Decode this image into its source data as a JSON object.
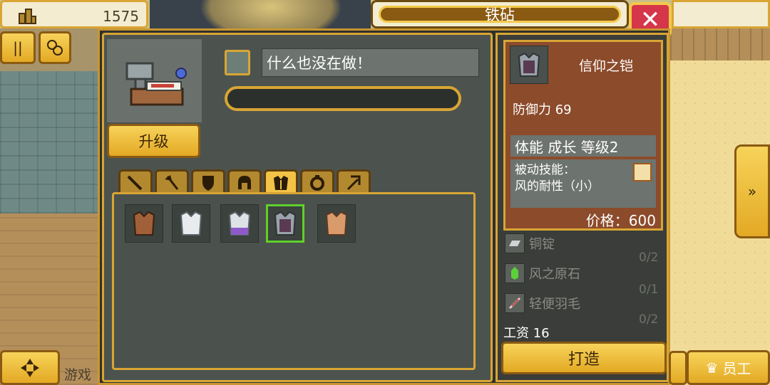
{
  "resource": {
    "value": "1575",
    "icon": "buildings-icon"
  },
  "window": {
    "title": "铁砧"
  },
  "status": {
    "text": "什么也没在做！",
    "progress": 0
  },
  "buttons": {
    "upgrade": "升级",
    "forge": "打造",
    "staff": "员工",
    "game_partial": "游戏"
  },
  "tabs": [
    {
      "name": "tab-sword",
      "icon": "sword-icon"
    },
    {
      "name": "tab-axe",
      "icon": "axe-icon"
    },
    {
      "name": "tab-shield",
      "icon": "shield-icon"
    },
    {
      "name": "tab-helmet",
      "icon": "helmet-icon"
    },
    {
      "name": "tab-armor",
      "icon": "armor-icon",
      "active": true
    },
    {
      "name": "tab-ring",
      "icon": "ring-icon"
    },
    {
      "name": "tab-pickaxe",
      "icon": "pickaxe-icon"
    }
  ],
  "item_colors": [
    "#a0603a",
    "#e8ecef",
    "#8e5ac8",
    "#9aa3aa",
    "#d99a6c"
  ],
  "selected_item_index": 3,
  "detail": {
    "name": "信仰之铠",
    "defense": "防御力 69",
    "tags": "体能 成长 等级2",
    "passive_line1": "被动技能：",
    "passive_line2": "风的耐性（小）",
    "price": "价格：600"
  },
  "materials": [
    {
      "name": "铜锭",
      "count": "0/2",
      "icon": "ingot-icon"
    },
    {
      "name": "风之原石",
      "count": "0/1",
      "icon": "green-crystal-icon"
    },
    {
      "name": "轻便羽毛",
      "count": "0/2",
      "icon": "feather-icon"
    }
  ],
  "wage": "工资 16"
}
